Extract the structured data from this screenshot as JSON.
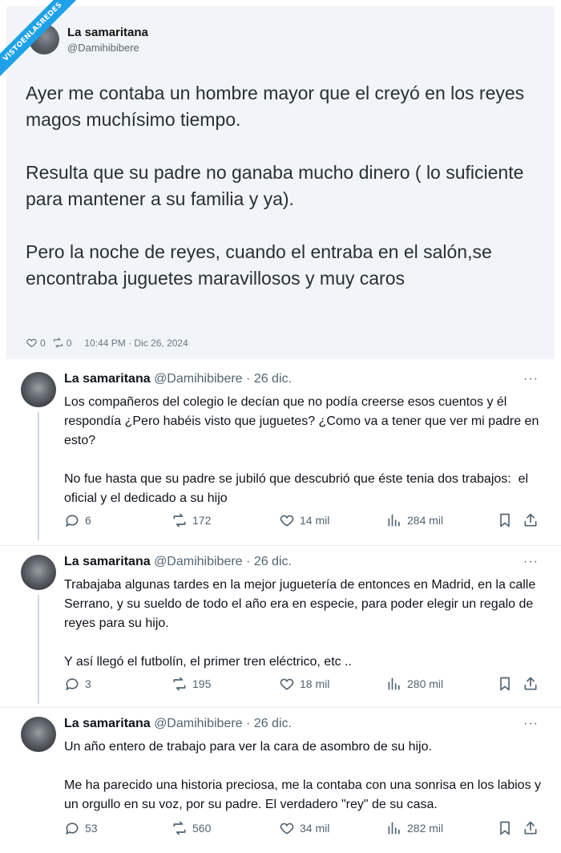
{
  "watermark": "VISTOENLASREDES",
  "main_tweet": {
    "author_name": "La samaritana",
    "author_handle": "@Damihibibere",
    "text": "Ayer me contaba un hombre mayor que el creyó en los reyes magos muchísimo tiempo.\n\nResulta que su padre no ganaba mucho dinero ( lo suficiente para mantener a su familia y ya).\n\nPero la noche de reyes, cuando el entraba en el salón,se encontraba juguetes maravillosos y muy caros",
    "likes": "0",
    "retweets": "0",
    "timestamp": "10:44 PM · Dic 26, 2024"
  },
  "replies": [
    {
      "author_name": "La samaritana",
      "author_handle": "@Damihibibere",
      "separator": "·",
      "date": "26 dic.",
      "text": "Los compañeros del colegio le decían que no podía creerse esos cuentos y él respondía ¿Pero habéis visto que juguetes? ¿Como va a tener que ver mi padre en esto?\n\nNo fue hasta que su padre se jubiló que descubrió que éste tenia dos trabajos:  el oficial y el dedicado a su hijo",
      "comments": "6",
      "retweets": "172",
      "likes": "14 mil",
      "views": "284 mil"
    },
    {
      "author_name": "La samaritana",
      "author_handle": "@Damihibibere",
      "separator": "·",
      "date": "26 dic.",
      "text": "Trabajaba algunas tardes en la mejor juguetería de entonces en Madrid, en la calle Serrano, y su sueldo de todo el año era en especie, para poder elegir un regalo de reyes para su hijo.\n\nY así llegó el futbolín, el primer tren eléctrico, etc ..",
      "comments": "3",
      "retweets": "195",
      "likes": "18 mil",
      "views": "280 mil"
    },
    {
      "author_name": "La samaritana",
      "author_handle": "@Damihibibere",
      "separator": "·",
      "date": "26 dic.",
      "text": "Un año entero de trabajo para ver la cara de asombro de su hijo.\n\nMe ha parecido una historia preciosa, me la contaba con una sonrisa en los labios y un orgullo en su voz, por su padre. El verdadero \"rey\" de su casa.",
      "comments": "53",
      "retweets": "560",
      "likes": "34 mil",
      "views": "282 mil"
    }
  ],
  "more_label": "···",
  "colors": {
    "accent": "#1ea1e8",
    "card_bg": "#f1f5f9",
    "muted": "#536471"
  }
}
